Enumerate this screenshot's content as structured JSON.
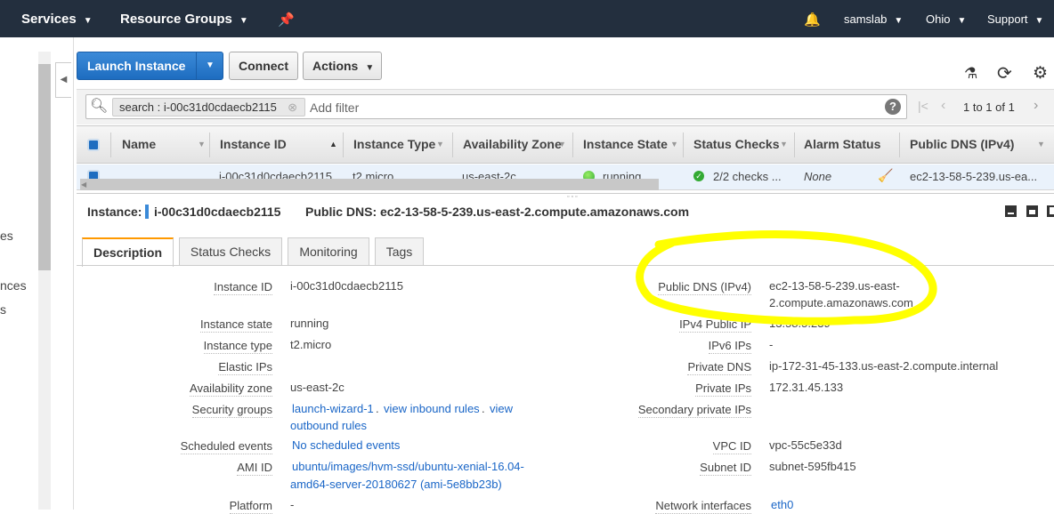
{
  "topnav": {
    "services": "Services",
    "resource_groups": "Resource Groups",
    "user": "samslab",
    "region": "Ohio",
    "support": "Support"
  },
  "sidebar": {
    "fragments": [
      "es",
      "nces",
      "s"
    ]
  },
  "toolbar": {
    "launch": "Launch Instance",
    "connect": "Connect",
    "actions": "Actions"
  },
  "search": {
    "token": "search : i-00c31d0cdaecb2115",
    "placeholder": "Add filter",
    "pagination": "1 to 1 of 1"
  },
  "table": {
    "columns": [
      "Name",
      "Instance ID",
      "Instance Type",
      "Availability Zone",
      "Instance State",
      "Status Checks",
      "Alarm Status",
      "Public DNS (IPv4)"
    ],
    "rows": [
      {
        "name": "",
        "instance_id": "i-00c31d0cdaecb2115",
        "type": "t2.micro",
        "zone": "us-east-2c",
        "state": "running",
        "checks": "2/2 checks ...",
        "alarm": "None",
        "dns": "ec2-13-58-5-239.us-ea..."
      }
    ]
  },
  "detail_header": {
    "instance_label": "Instance:",
    "instance_id": "i-00c31d0cdaecb2115",
    "dns_label": "Public DNS:",
    "dns": "ec2-13-58-5-239.us-east-2.compute.amazonaws.com"
  },
  "tabs": [
    "Description",
    "Status Checks",
    "Monitoring",
    "Tags"
  ],
  "left_fields": [
    {
      "label": "Instance ID",
      "value": "i-00c31d0cdaecb2115"
    },
    {
      "label": "Instance state",
      "value": "running"
    },
    {
      "label": "Instance type",
      "value": "t2.micro"
    },
    {
      "label": "Elastic IPs",
      "value": ""
    },
    {
      "label": "Availability zone",
      "value": "us-east-2c"
    },
    {
      "label": "Security groups",
      "value": "launch-wizard-1",
      "link2": "view inbound rules",
      "link3": "view",
      "link3b": "outbound rules"
    },
    {
      "label": "Scheduled events",
      "value": "No scheduled events"
    },
    {
      "label": "AMI ID",
      "value": "ubuntu/images/hvm-ssd/ubuntu-xenial-16.04-",
      "value2": "amd64-server-20180627 (ami-5e8bb23b)"
    },
    {
      "label": "Platform",
      "value": "-"
    }
  ],
  "right_fields": [
    {
      "label": "Public DNS (IPv4)",
      "value": "ec2-13-58-5-239.us-east-",
      "value2": "2.compute.amazonaws.com"
    },
    {
      "label": "IPv4 Public IP",
      "value": "13.58.5.239"
    },
    {
      "label": "IPv6 IPs",
      "value": "-"
    },
    {
      "label": "Private DNS",
      "value": "ip-172-31-45-133.us-east-2.compute.internal"
    },
    {
      "label": "Private IPs",
      "value": "172.31.45.133"
    },
    {
      "label": "Secondary private IPs",
      "value": ""
    },
    {
      "label": "VPC ID",
      "value": "vpc-55c5e33d"
    },
    {
      "label": "Subnet ID",
      "value": "subnet-595fb415"
    },
    {
      "label": "Network interfaces",
      "value": "eth0"
    }
  ],
  "colors": {
    "nav": "#232f3e",
    "primary": "#1e6dc0",
    "highlight": "#ffff00",
    "tab_accent": "#ff9900"
  }
}
